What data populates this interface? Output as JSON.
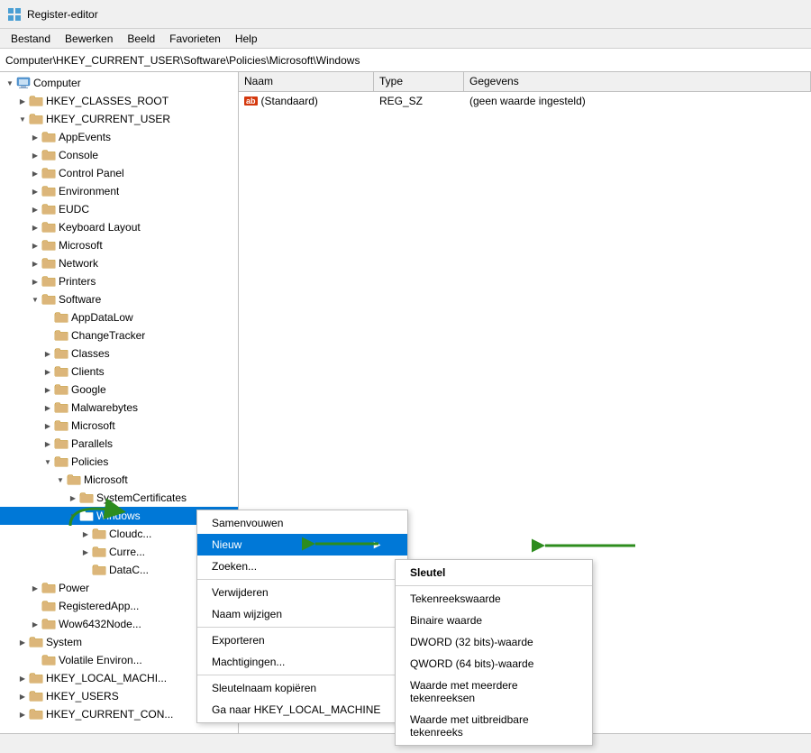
{
  "titleBar": {
    "icon": "registry-editor-icon",
    "title": "Register-editor"
  },
  "menuBar": {
    "items": [
      "Bestand",
      "Bewerken",
      "Beeld",
      "Favorieten",
      "Help"
    ]
  },
  "addressBar": {
    "path": "Computer\\HKEY_CURRENT_USER\\Software\\Policies\\Microsoft\\Windows"
  },
  "dataPanel": {
    "columns": [
      "Naam",
      "Type",
      "Gegevens"
    ],
    "rows": [
      {
        "badge": "ab",
        "name": "(Standaard)",
        "type": "REG_SZ",
        "value": "(geen waarde ingesteld)"
      }
    ]
  },
  "treeItems": [
    {
      "id": "computer",
      "label": "Computer",
      "indent": 0,
      "expanded": true,
      "hasArrow": true,
      "isComputer": true
    },
    {
      "id": "hkcr",
      "label": "HKEY_CLASSES_ROOT",
      "indent": 1,
      "expanded": false,
      "hasArrow": true
    },
    {
      "id": "hkcu",
      "label": "HKEY_CURRENT_USER",
      "indent": 1,
      "expanded": true,
      "hasArrow": true
    },
    {
      "id": "appevents",
      "label": "AppEvents",
      "indent": 2,
      "expanded": false,
      "hasArrow": true
    },
    {
      "id": "console",
      "label": "Console",
      "indent": 2,
      "expanded": false,
      "hasArrow": true
    },
    {
      "id": "controlpanel",
      "label": "Control Panel",
      "indent": 2,
      "expanded": false,
      "hasArrow": true
    },
    {
      "id": "environment",
      "label": "Environment",
      "indent": 2,
      "expanded": false,
      "hasArrow": true
    },
    {
      "id": "eudc",
      "label": "EUDC",
      "indent": 2,
      "expanded": false,
      "hasArrow": true
    },
    {
      "id": "keyboardlayout",
      "label": "Keyboard Layout",
      "indent": 2,
      "expanded": false,
      "hasArrow": true
    },
    {
      "id": "microsoft",
      "label": "Microsoft",
      "indent": 2,
      "expanded": false,
      "hasArrow": true
    },
    {
      "id": "network",
      "label": "Network",
      "indent": 2,
      "expanded": false,
      "hasArrow": true
    },
    {
      "id": "printers",
      "label": "Printers",
      "indent": 2,
      "expanded": false,
      "hasArrow": true
    },
    {
      "id": "software",
      "label": "Software",
      "indent": 2,
      "expanded": true,
      "hasArrow": true
    },
    {
      "id": "appdatalow",
      "label": "AppDataLow",
      "indent": 3,
      "expanded": false,
      "hasArrow": false
    },
    {
      "id": "changetracker",
      "label": "ChangeTracker",
      "indent": 3,
      "expanded": false,
      "hasArrow": false
    },
    {
      "id": "classes",
      "label": "Classes",
      "indent": 3,
      "expanded": false,
      "hasArrow": true
    },
    {
      "id": "clients",
      "label": "Clients",
      "indent": 3,
      "expanded": false,
      "hasArrow": true
    },
    {
      "id": "google",
      "label": "Google",
      "indent": 3,
      "expanded": false,
      "hasArrow": true
    },
    {
      "id": "malwarebytes",
      "label": "Malwarebytes",
      "indent": 3,
      "expanded": false,
      "hasArrow": true
    },
    {
      "id": "microsoft2",
      "label": "Microsoft",
      "indent": 3,
      "expanded": false,
      "hasArrow": true
    },
    {
      "id": "parallels",
      "label": "Parallels",
      "indent": 3,
      "expanded": false,
      "hasArrow": true
    },
    {
      "id": "policies",
      "label": "Policies",
      "indent": 3,
      "expanded": true,
      "hasArrow": true
    },
    {
      "id": "pol-microsoft",
      "label": "Microsoft",
      "indent": 4,
      "expanded": true,
      "hasArrow": true
    },
    {
      "id": "systemcert",
      "label": "SystemCertificates",
      "indent": 5,
      "expanded": false,
      "hasArrow": true
    },
    {
      "id": "windows",
      "label": "Windows",
      "indent": 5,
      "expanded": true,
      "hasArrow": true,
      "selected": true
    },
    {
      "id": "cloudc",
      "label": "Cloudc...",
      "indent": 6,
      "expanded": false,
      "hasArrow": true
    },
    {
      "id": "curre",
      "label": "Curre...",
      "indent": 6,
      "expanded": false,
      "hasArrow": true
    },
    {
      "id": "datac",
      "label": "DataC...",
      "indent": 6,
      "expanded": false,
      "hasArrow": false
    },
    {
      "id": "power",
      "label": "Power",
      "indent": 2,
      "expanded": false,
      "hasArrow": true
    },
    {
      "id": "registeredapp",
      "label": "RegisteredApp...",
      "indent": 2,
      "expanded": false,
      "hasArrow": false
    },
    {
      "id": "wow6432",
      "label": "Wow6432Node...",
      "indent": 2,
      "expanded": false,
      "hasArrow": true
    },
    {
      "id": "system",
      "label": "System",
      "indent": 1,
      "expanded": false,
      "hasArrow": true
    },
    {
      "id": "volatileenv",
      "label": "Volatile Environ...",
      "indent": 2,
      "expanded": false,
      "hasArrow": false
    },
    {
      "id": "hklm",
      "label": "HKEY_LOCAL_MACHI...",
      "indent": 1,
      "expanded": false,
      "hasArrow": true
    },
    {
      "id": "hku",
      "label": "HKEY_USERS",
      "indent": 1,
      "expanded": false,
      "hasArrow": true
    },
    {
      "id": "hkcc",
      "label": "HKEY_CURRENT_CON...",
      "indent": 1,
      "expanded": false,
      "hasArrow": true
    }
  ],
  "contextMenu": {
    "items": [
      {
        "label": "Samenvouwen",
        "type": "item"
      },
      {
        "label": "Nieuw",
        "type": "item-submenu"
      },
      {
        "label": "Zoeken...",
        "type": "item"
      },
      {
        "type": "separator"
      },
      {
        "label": "Verwijderen",
        "type": "item"
      },
      {
        "label": "Naam wijzigen",
        "type": "item"
      },
      {
        "type": "separator"
      },
      {
        "label": "Exporteren",
        "type": "item"
      },
      {
        "label": "Machtigingen...",
        "type": "item"
      },
      {
        "type": "separator"
      },
      {
        "label": "Sleutelnaam kopiëren",
        "type": "item"
      },
      {
        "label": "Ga naar HKEY_LOCAL_MACHINE",
        "type": "item"
      }
    ]
  },
  "submenu": {
    "items": [
      {
        "label": "Sleutel",
        "bold": true
      },
      {
        "type": "separator"
      },
      {
        "label": "Tekenreekswaarde"
      },
      {
        "label": "Binaire waarde"
      },
      {
        "label": "DWORD (32 bits)-waarde"
      },
      {
        "label": "QWORD (64 bits)-waarde"
      },
      {
        "label": "Waarde met meerdere tekenreeksen"
      },
      {
        "label": "Waarde met uitbreidbare tekenreeks"
      }
    ]
  },
  "statusBar": {
    "text": ""
  },
  "colors": {
    "accent": "#0078d7",
    "folderColor": "#dcb67a",
    "folderDark": "#c9a055",
    "selectedBg": "#0078d7",
    "green": "#2d8c1e"
  }
}
